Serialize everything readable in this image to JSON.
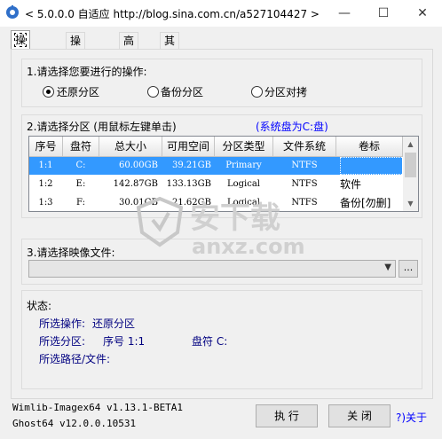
{
  "window": {
    "title": "< 5.0.0.0 自适应 http://blog.sina.com.cn/a527104427 >",
    "minimize_glyph": "—",
    "maximize_glyph": "☐",
    "close_glyph": "✕"
  },
  "tabs": [
    "操作分区",
    "操作硬盘",
    "高 级",
    "其 它"
  ],
  "section1": {
    "label": "1.请选择您要进行的操作:",
    "options": [
      "还原分区",
      "备份分区",
      "分区对拷"
    ],
    "selected_index": 0
  },
  "section2": {
    "label": "2.请选择分区 (用鼠标左键单击)",
    "system_disk": "(系统盘为C:盘)",
    "columns": [
      "序号",
      "盘符",
      "总大小",
      "可用空间",
      "分区类型",
      "文件系统",
      "卷标"
    ],
    "rows": [
      [
        "1:1",
        "C:",
        "60.00GB",
        "39.21GB",
        "Primary",
        "NTFS",
        ""
      ],
      [
        "1:2",
        "E:",
        "142.87GB",
        "133.13GB",
        "Logical",
        "NTFS",
        "软件"
      ],
      [
        "1:3",
        "F:",
        "30.01GB",
        "21.62GB",
        "Logical",
        "NTFS",
        "备份[勿删]"
      ]
    ],
    "selected_row": 0
  },
  "section3": {
    "label": "3.请选择映像文件:",
    "combo_value": "",
    "browse_label": "..."
  },
  "status": {
    "label": "状态:",
    "op_label": "所选操作:",
    "op_value": "还原分区",
    "part_label": "所选分区:",
    "part_no_label": "序号 1:1",
    "part_drive_label": "盘符 C:",
    "path_label": "所选路径/文件:"
  },
  "footer": {
    "version1": "Wimlib-Imagex64 v1.13.1-BETA1",
    "version2": "Ghost64 v12.0.0.10531",
    "execute_label": "执 行",
    "close_label": "关 闭",
    "about_label": "?)关于"
  },
  "watermark": {
    "cn_text": "安下载",
    "url_text": "anxz.com"
  },
  "colors": {
    "selection": "#3399ff",
    "link_blue": "#0000ff",
    "status_navy": "#000080"
  },
  "icons": {
    "app": "gear-disk-icon",
    "dropdown": "chevron-down-icon"
  }
}
